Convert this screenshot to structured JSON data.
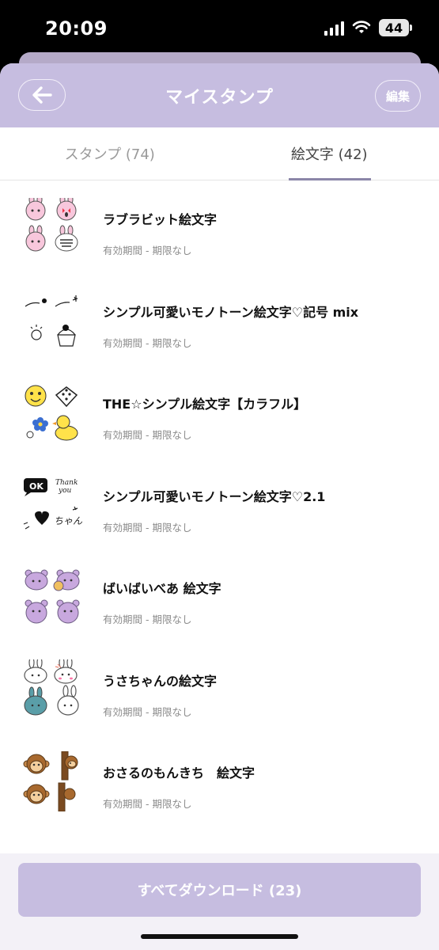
{
  "status_bar": {
    "time": "20:09",
    "battery": "44"
  },
  "header": {
    "title": "マイスタンプ",
    "edit_label": "編集"
  },
  "tabs": [
    {
      "label": "スタンプ (74)"
    },
    {
      "label": "絵文字 (42)"
    }
  ],
  "items": [
    {
      "title": "ラブラビット絵文字",
      "subtitle": "有効期間 - 期限なし"
    },
    {
      "title": "シンプル可愛いモノトーン絵文字♡記号 mix",
      "subtitle": "有効期間 - 期限なし"
    },
    {
      "title": "THE☆シンプル絵文字【カラフル】",
      "subtitle": "有効期間 - 期限なし"
    },
    {
      "title": "シンプル可愛いモノトーン絵文字♡2.1",
      "subtitle": "有効期間 - 期限なし"
    },
    {
      "title": "ばいばいべあ 絵文字",
      "subtitle": "有効期間 - 期限なし"
    },
    {
      "title": "うさちゃんの絵文字",
      "subtitle": "有効期間 - 期限なし"
    },
    {
      "title": "おさるのもんきち　絵文字",
      "subtitle": "有効期間 - 期限なし"
    }
  ],
  "download_all": {
    "label": "すべてダウンロード (23)"
  },
  "colors": {
    "accent": "#c6bde0",
    "header_bg": "#c6bde0",
    "tab_underline": "#8b86a8"
  }
}
